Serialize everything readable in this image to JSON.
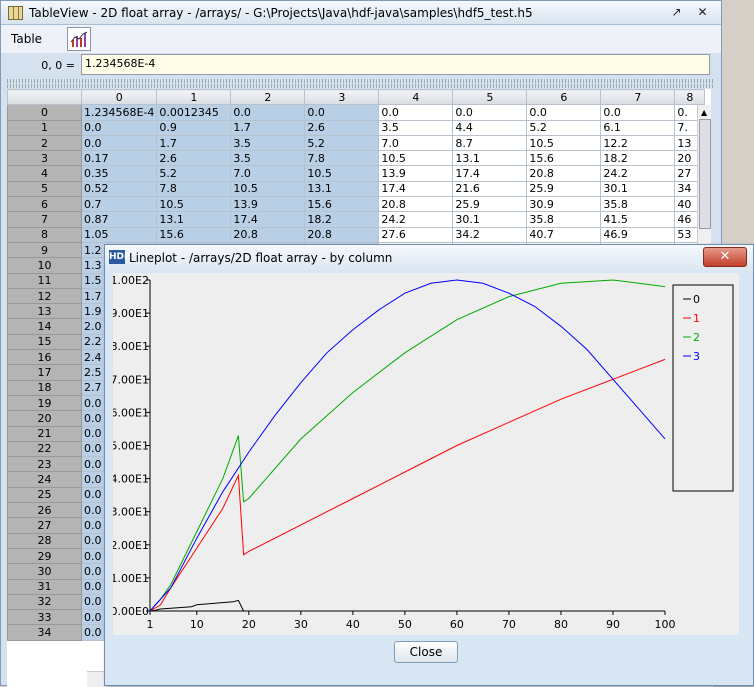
{
  "window": {
    "title": "TableView  -  2D float array  -  /arrays/  -  G:\\Projects\\Java\\hdf-java\\samples\\hdf5_test.h5"
  },
  "menu": {
    "table": "Table",
    "chart_icon": "line-chart-icon"
  },
  "cell": {
    "label": "0, 0  =",
    "value": "1.234568E-4"
  },
  "table": {
    "columns": [
      "0",
      "1",
      "2",
      "3",
      "4",
      "5",
      "6",
      "7",
      "8"
    ],
    "rows": [
      {
        "h": "0",
        "c": [
          "1.234568E-4",
          "0.0012345",
          "0.0",
          "0.0",
          "0.0",
          "0.0",
          "0.0",
          "0.0",
          "0."
        ]
      },
      {
        "h": "1",
        "c": [
          "0.0",
          "0.9",
          "1.7",
          "2.6",
          "3.5",
          "4.4",
          "5.2",
          "6.1",
          "7."
        ]
      },
      {
        "h": "2",
        "c": [
          "0.0",
          "1.7",
          "3.5",
          "5.2",
          "7.0",
          "8.7",
          "10.5",
          "12.2",
          "13"
        ]
      },
      {
        "h": "3",
        "c": [
          "0.17",
          "2.6",
          "3.5",
          "7.8",
          "10.5",
          "13.1",
          "15.6",
          "18.2",
          "20"
        ]
      },
      {
        "h": "4",
        "c": [
          "0.35",
          "5.2",
          "7.0",
          "10.5",
          "13.9",
          "17.4",
          "20.8",
          "24.2",
          "27"
        ]
      },
      {
        "h": "5",
        "c": [
          "0.52",
          "7.8",
          "10.5",
          "13.1",
          "17.4",
          "21.6",
          "25.9",
          "30.1",
          "34"
        ]
      },
      {
        "h": "6",
        "c": [
          "0.7",
          "10.5",
          "13.9",
          "15.6",
          "20.8",
          "25.9",
          "30.9",
          "35.8",
          "40"
        ]
      },
      {
        "h": "7",
        "c": [
          "0.87",
          "13.1",
          "17.4",
          "18.2",
          "24.2",
          "30.1",
          "35.8",
          "41.5",
          "46"
        ]
      },
      {
        "h": "8",
        "c": [
          "1.05",
          "15.6",
          "20.8",
          "20.8",
          "27.6",
          "34.2",
          "40.7",
          "46.9",
          "53"
        ]
      },
      {
        "h": "9",
        "c": [
          "1.2",
          "",
          "",
          "",
          "",
          "",
          "",
          "",
          ""
        ]
      },
      {
        "h": "10",
        "c": [
          "1.3",
          "",
          "",
          "",
          "",
          "",
          "",
          "",
          ""
        ]
      },
      {
        "h": "11",
        "c": [
          "1.5",
          "",
          "",
          "",
          "",
          "",
          "",
          "",
          ""
        ]
      },
      {
        "h": "12",
        "c": [
          "1.7",
          "",
          "",
          "",
          "",
          "",
          "",
          "",
          ""
        ]
      },
      {
        "h": "13",
        "c": [
          "1.9",
          "",
          "",
          "",
          "",
          "",
          "",
          "",
          ""
        ]
      },
      {
        "h": "14",
        "c": [
          "2.0",
          "",
          "",
          "",
          "",
          "",
          "",
          "",
          ""
        ]
      },
      {
        "h": "15",
        "c": [
          "2.2",
          "",
          "",
          "",
          "",
          "",
          "",
          "",
          ""
        ]
      },
      {
        "h": "16",
        "c": [
          "2.4",
          "",
          "",
          "",
          "",
          "",
          "",
          "",
          ""
        ]
      },
      {
        "h": "17",
        "c": [
          "2.5",
          "",
          "",
          "",
          "",
          "",
          "",
          "",
          ""
        ]
      },
      {
        "h": "18",
        "c": [
          "2.7",
          "",
          "",
          "",
          "",
          "",
          "",
          "",
          ""
        ]
      },
      {
        "h": "19",
        "c": [
          "0.0",
          "",
          "",
          "",
          "",
          "",
          "",
          "",
          ""
        ]
      },
      {
        "h": "20",
        "c": [
          "0.0",
          "",
          "",
          "",
          "",
          "",
          "",
          "",
          ""
        ]
      },
      {
        "h": "21",
        "c": [
          "0.0",
          "",
          "",
          "",
          "",
          "",
          "",
          "",
          ""
        ]
      },
      {
        "h": "22",
        "c": [
          "0.0",
          "",
          "",
          "",
          "",
          "",
          "",
          "",
          ""
        ]
      },
      {
        "h": "23",
        "c": [
          "0.0",
          "",
          "",
          "",
          "",
          "",
          "",
          "",
          ""
        ]
      },
      {
        "h": "24",
        "c": [
          "0.0",
          "",
          "",
          "",
          "",
          "",
          "",
          "",
          ""
        ]
      },
      {
        "h": "25",
        "c": [
          "0.0",
          "",
          "",
          "",
          "",
          "",
          "",
          "",
          ""
        ]
      },
      {
        "h": "26",
        "c": [
          "0.0",
          "",
          "",
          "",
          "",
          "",
          "",
          "",
          ""
        ]
      },
      {
        "h": "27",
        "c": [
          "0.0",
          "",
          "",
          "",
          "",
          "",
          "",
          "",
          ""
        ]
      },
      {
        "h": "28",
        "c": [
          "0.0",
          "",
          "",
          "",
          "",
          "",
          "",
          "",
          ""
        ]
      },
      {
        "h": "29",
        "c": [
          "0.0",
          "",
          "",
          "",
          "",
          "",
          "",
          "",
          ""
        ]
      },
      {
        "h": "30",
        "c": [
          "0.0",
          "",
          "",
          "",
          "",
          "",
          "",
          "",
          ""
        ]
      },
      {
        "h": "31",
        "c": [
          "0.0",
          "",
          "",
          "",
          "",
          "",
          "",
          "",
          ""
        ]
      },
      {
        "h": "32",
        "c": [
          "0.0",
          "",
          "",
          "",
          "",
          "",
          "",
          "",
          ""
        ]
      },
      {
        "h": "33",
        "c": [
          "0.0",
          "",
          "",
          "",
          "",
          "",
          "",
          "",
          ""
        ]
      },
      {
        "h": "34",
        "c": [
          "0.0",
          "",
          "",
          "",
          "",
          "",
          "",
          "",
          ""
        ]
      }
    ],
    "selected_columns": [
      "0",
      "1",
      "2",
      "3"
    ]
  },
  "lineplot": {
    "title": "Lineplot - /arrays/2D float array - by column",
    "close_label": "Close"
  },
  "chart_data": {
    "type": "line",
    "title": "",
    "xlabel": "",
    "ylabel": "",
    "xlim": [
      1,
      100
    ],
    "ylim": [
      0,
      100
    ],
    "grid": false,
    "legend": "right",
    "x_ticks": [
      "1",
      "10",
      "20",
      "30",
      "40",
      "50",
      "60",
      "70",
      "80",
      "90",
      "100"
    ],
    "y_ticks": [
      "0.00E0",
      "1.00E1",
      "2.00E1",
      "3.00E1",
      "4.00E1",
      "5.00E1",
      "6.00E1",
      "7.00E1",
      "8.00E1",
      "9.00E1",
      "1.00E2"
    ],
    "series": [
      {
        "name": "0",
        "color": "#000000",
        "x": [
          1,
          2,
          3,
          9,
          10,
          17,
          18,
          19
        ],
        "y": [
          0,
          0.2,
          0.6,
          1.3,
          1.9,
          2.8,
          3.2,
          0.0
        ]
      },
      {
        "name": "1",
        "color": "#ff0000",
        "x": [
          1,
          2,
          3,
          5,
          10,
          15,
          18,
          19,
          20,
          30,
          40,
          50,
          60,
          70,
          80,
          90,
          100
        ],
        "y": [
          0,
          0.9,
          1.8,
          7,
          19,
          31,
          41,
          17,
          18,
          26,
          34,
          42,
          50,
          57,
          64,
          70,
          76
        ]
      },
      {
        "name": "2",
        "color": "#00aa00",
        "x": [
          1,
          2,
          3,
          5,
          10,
          15,
          18,
          19,
          20,
          30,
          40,
          50,
          60,
          70,
          80,
          90,
          100
        ],
        "y": [
          0,
          1.7,
          3.5,
          8,
          24,
          40,
          53,
          33,
          34,
          52,
          66,
          78,
          88,
          95,
          99,
          100,
          98
        ]
      },
      {
        "name": "3",
        "color": "#0000ff",
        "x": [
          1,
          2,
          3,
          5,
          10,
          15,
          20,
          25,
          30,
          35,
          40,
          45,
          50,
          55,
          60,
          65,
          70,
          75,
          80,
          85,
          90,
          95,
          100
        ],
        "y": [
          0,
          1.8,
          3.5,
          7,
          22,
          36,
          48,
          59,
          69,
          78,
          85,
          91,
          96,
          99,
          100,
          99,
          96,
          92,
          86,
          79,
          70,
          61,
          52
        ]
      }
    ]
  }
}
